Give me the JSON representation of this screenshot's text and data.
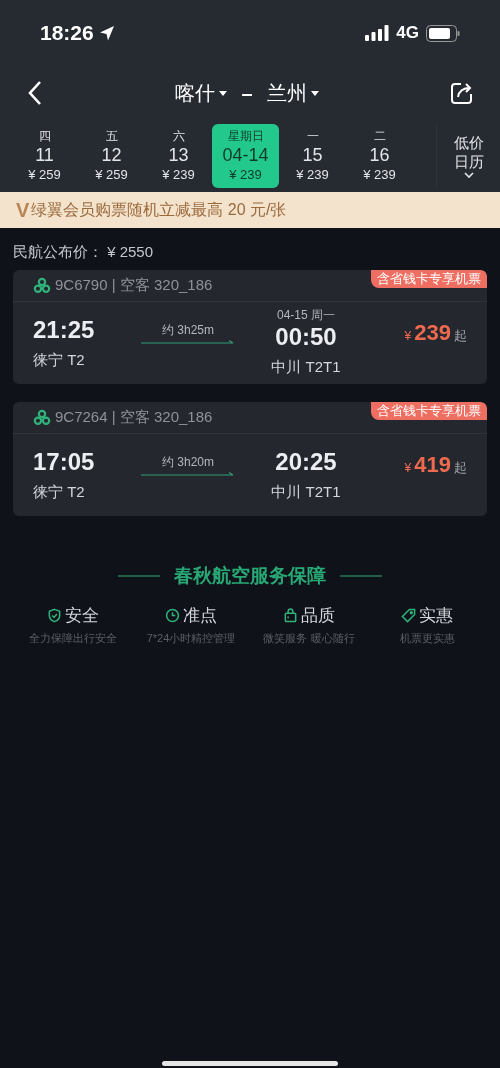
{
  "status_bar": {
    "time": "18:26",
    "network": "4G"
  },
  "header": {
    "from": "喀什",
    "separator": "–",
    "to": "兰州"
  },
  "dates": [
    {
      "weekday": "四",
      "date": "11",
      "price": "¥ 259",
      "selected": false
    },
    {
      "weekday": "五",
      "date": "12",
      "price": "¥ 259",
      "selected": false
    },
    {
      "weekday": "六",
      "date": "13",
      "price": "¥ 239",
      "selected": false
    },
    {
      "weekday": "星期日",
      "date": "04-14",
      "price": "¥ 239",
      "selected": true
    },
    {
      "weekday": "一",
      "date": "15",
      "price": "¥ 239",
      "selected": false
    },
    {
      "weekday": "二",
      "date": "16",
      "price": "¥ 239",
      "selected": false
    }
  ],
  "calendar_button": {
    "line_1": "低价",
    "line_2": "日历"
  },
  "promo_banner": {
    "mark": "V",
    "text": "绿翼会员购票随机立减最高 20 元/张"
  },
  "public_fare": "民航公布价： ¥ 2550",
  "flights": [
    {
      "flight": "9C6790 | 空客 320_186",
      "tag": "含省钱卡专享机票",
      "depart_time": "21:25",
      "depart_airport": "徕宁 T2",
      "duration": "约 3h25m",
      "arrive_note": "04-15 周一",
      "arrive_time": "00:50",
      "arrive_airport": "中川 T2T1",
      "currency": "¥",
      "price": "239",
      "suffix": "起"
    },
    {
      "flight": "9C7264 | 空客 320_186",
      "tag": "含省钱卡专享机票",
      "depart_time": "17:05",
      "depart_airport": "徕宁 T2",
      "duration": "约 3h20m",
      "arrive_time": "20:25",
      "arrive_airport": "中川 T2T1",
      "currency": "¥",
      "price": "419",
      "suffix": "起"
    }
  ],
  "guarantee": {
    "title": "春秋航空服务保障",
    "items": [
      {
        "kind": "shield",
        "label": "安全",
        "note": "全力保障出行安全"
      },
      {
        "kind": "clock",
        "label": "准点",
        "note": "7*24小时精控管理"
      },
      {
        "kind": "bag",
        "label": "品质",
        "note": "微笑服务 暖心随行"
      },
      {
        "kind": "tag",
        "label": "实惠",
        "note": "机票更实惠"
      }
    ]
  }
}
